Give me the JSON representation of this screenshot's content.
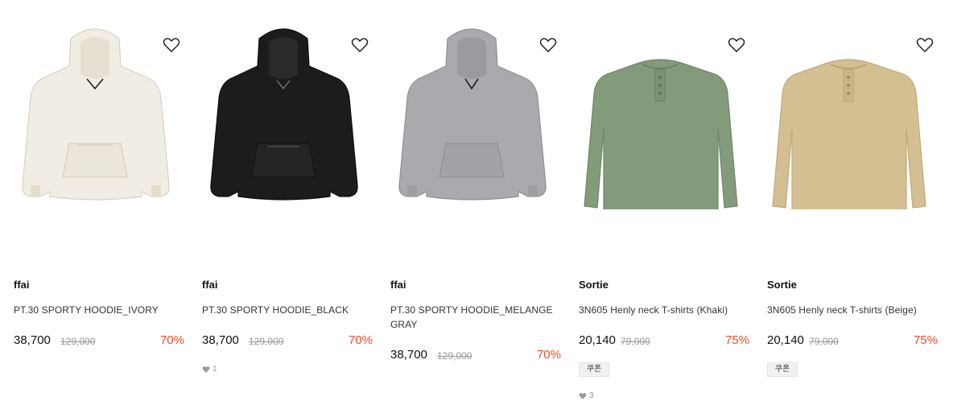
{
  "icons": {
    "wishlist": "heart-outline-icon",
    "likes": "heart-filled-icon"
  },
  "colors": {
    "discount": "#ef4b23",
    "ivory": "#f1ede4",
    "black": "#1c1c1c",
    "melange": "#a9aaad",
    "khaki": "#839b7b",
    "beige": "#d4bf93"
  },
  "products": [
    {
      "brand": "ffai",
      "name": "PT.30 SPORTY HOODIE_IVORY",
      "price": "38,700",
      "original_price": "129,000",
      "discount": "70%"
    },
    {
      "brand": "ffai",
      "name": "PT.30 SPORTY HOODIE_BLACK",
      "price": "38,700",
      "original_price": "129,000",
      "discount": "70%",
      "likes": "1"
    },
    {
      "brand": "ffai",
      "name": "PT.30 SPORTY HOODIE_MELANGE GRAY",
      "price": "38,700",
      "original_price": "129,000",
      "discount": "70%"
    },
    {
      "brand": "Sortie",
      "name": "3N605 Henly neck T-shirts (Khaki)",
      "price": "20,140",
      "original_price": "79,000",
      "discount": "75%",
      "coupon": "쿠폰",
      "likes": "3"
    },
    {
      "brand": "Sortie",
      "name": "3N605 Henly neck T-shirts (Beige)",
      "price": "20,140",
      "original_price": "79,000",
      "discount": "75%",
      "coupon": "쿠폰"
    }
  ]
}
